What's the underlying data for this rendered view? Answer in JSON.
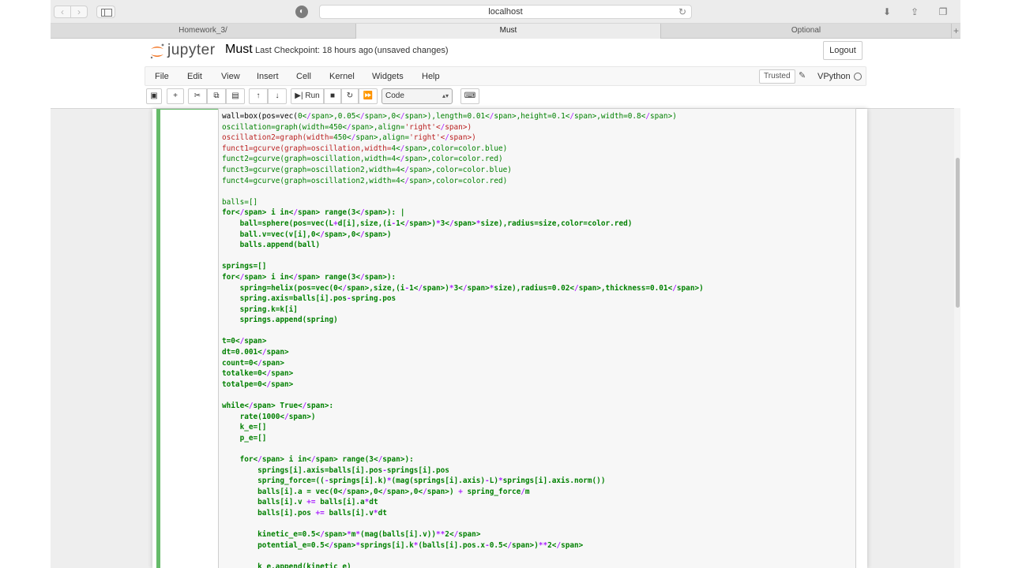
{
  "browser": {
    "url": "localhost",
    "tabs": [
      {
        "label": "Homework_3/"
      },
      {
        "label": "Must"
      },
      {
        "label": "Optional"
      }
    ]
  },
  "jupyter": {
    "logo_text": "jupyter",
    "notebook_name": "Must",
    "checkpoint": "Last Checkpoint: 18 hours ago",
    "unsaved": "(unsaved changes)",
    "logout_label": "Logout",
    "menu": [
      "File",
      "Edit",
      "View",
      "Insert",
      "Cell",
      "Kernel",
      "Widgets",
      "Help"
    ],
    "trusted_label": "Trusted",
    "kernel_name": "VPython",
    "run_label": "Run",
    "cell_type": "Code"
  },
  "code_lines": [
    "wall=box(pos=vec(0,0.05,0),length=0.01,height=0.1,width=0.8)",
    "oscillation=graph(width=450,align='right')",
    "oscillation2=graph(width=450,align='right')",
    "funct1=gcurve(graph=oscillation,width=4,color=color.blue)",
    "funct2=gcurve(graph=oscillation,width=4,color=color.red)",
    "funct3=gcurve(graph=oscillation2,width=4,color=color.blue)",
    "funct4=gcurve(graph=oscillation2,width=4,color=color.red)",
    "",
    "balls=[]",
    "for i in range(3): |",
    "    ball=sphere(pos=vec(L+d[i],size,(i-1)*3*size),radius=size,color=color.red)",
    "    ball.v=vec(v[i],0,0)",
    "    balls.append(ball)",
    "",
    "springs=[]",
    "for i in range(3):",
    "    spring=helix(pos=vec(0,size,(i-1)*3*size),radius=0.02,thickness=0.01)",
    "    spring.axis=balls[i].pos-spring.pos",
    "    spring.k=k[i]",
    "    springs.append(spring)",
    "",
    "t=0",
    "dt=0.001",
    "count=0",
    "totalke=0",
    "totalpe=0",
    "",
    "while True:",
    "    rate(1000)",
    "    k_e=[]",
    "    p_e=[]",
    "",
    "    for i in range(3):",
    "        springs[i].axis=balls[i].pos-springs[i].pos",
    "        spring_force=((-springs[i].k)*(mag(springs[i].axis)-L)*springs[i].axis.norm())",
    "        balls[i].a = vec(0,0,0) + spring_force/m",
    "        balls[i].v += balls[i].a*dt",
    "        balls[i].pos += balls[i].v*dt",
    "",
    "        kinetic_e=0.5*m*(mag(balls[i].v))**2",
    "        potential_e=0.5*springs[i].k*(balls[i].pos.x-0.5)**2",
    "",
    "        k_e.append(kinetic_e)"
  ]
}
